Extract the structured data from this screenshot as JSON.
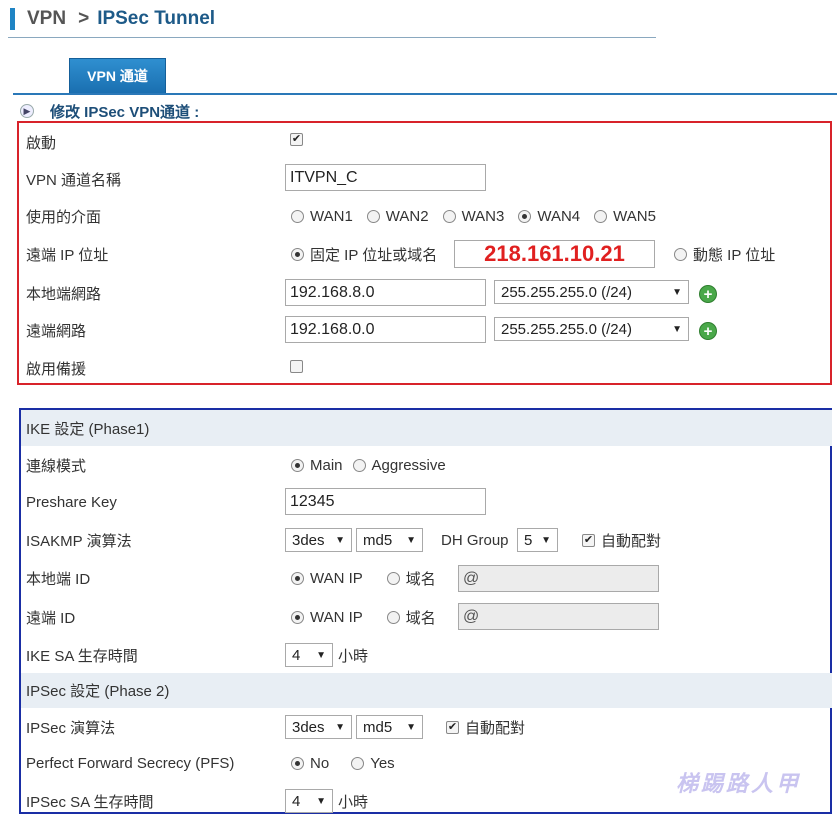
{
  "breadcrumb": {
    "root": "VPN",
    "separator": ">",
    "current": "IPSec Tunnel"
  },
  "tab": {
    "label": "VPN 通道"
  },
  "section_title": "修改 IPSec VPN通道 :",
  "basic": {
    "enable": {
      "label": "啟動",
      "checked": true
    },
    "tunnel_name": {
      "label": "VPN 通道名稱",
      "value": "ITVPN_C"
    },
    "interface": {
      "label": "使用的介面",
      "options": [
        "WAN1",
        "WAN2",
        "WAN3",
        "WAN4",
        "WAN5"
      ],
      "selected": "WAN4"
    },
    "remote_ip": {
      "label": "遠端 IP 位址",
      "fixed_label": "固定 IP 位址或域名",
      "fixed_value": "218.161.10.21",
      "dynamic_label": "動態 IP 位址",
      "selected": "fixed"
    },
    "local_network": {
      "label": "本地端網路",
      "ip": "192.168.8.0",
      "mask": "255.255.255.0 (/24)"
    },
    "remote_network": {
      "label": "遠端網路",
      "ip": "192.168.0.0",
      "mask": "255.255.255.0 (/24)"
    },
    "backup": {
      "label": "啟用備援",
      "checked": false
    }
  },
  "ike": {
    "header": "IKE 設定 (Phase1)",
    "mode": {
      "label": "連線模式",
      "options": [
        "Main",
        "Aggressive"
      ],
      "selected": "Main"
    },
    "psk": {
      "label": "Preshare Key",
      "value": "12345"
    },
    "isakmp": {
      "label": "ISAKMP 演算法",
      "enc": "3des",
      "hash": "md5",
      "dh_label": "DH Group",
      "dh": "5",
      "auto_label": "自動配對",
      "auto_checked": true
    },
    "local_id": {
      "label": "本地端 ID",
      "opt1": "WAN IP",
      "opt2": "域名",
      "value": "@"
    },
    "remote_id": {
      "label": "遠端 ID",
      "opt1": "WAN IP",
      "opt2": "域名",
      "value": "@"
    },
    "sa_life": {
      "label": "IKE SA 生存時間",
      "value": "4",
      "unit": "小時"
    }
  },
  "ipsec": {
    "header": "IPSec 設定 (Phase 2)",
    "algo": {
      "label": "IPSec 演算法",
      "enc": "3des",
      "hash": "md5",
      "auto_label": "自動配對",
      "auto_checked": true
    },
    "pfs": {
      "label": "Perfect Forward Secrecy (PFS)",
      "options": [
        "No",
        "Yes"
      ],
      "selected": "No"
    },
    "sa_life": {
      "label": "IPSec SA 生存時間",
      "value": "4",
      "unit": "小時"
    }
  },
  "watermark": "梯踢路人甲",
  "colors": {
    "accent": "#1f84c4",
    "highlight_box": "#d8232a",
    "ike_box": "#1a2ea5",
    "plus": "#4aa84a",
    "ip_text": "#e02020"
  },
  "icons": {
    "checked": "checkmark",
    "add": "plus-circle",
    "dropdown": "triangle-down",
    "section": "chevron-right-circle"
  }
}
